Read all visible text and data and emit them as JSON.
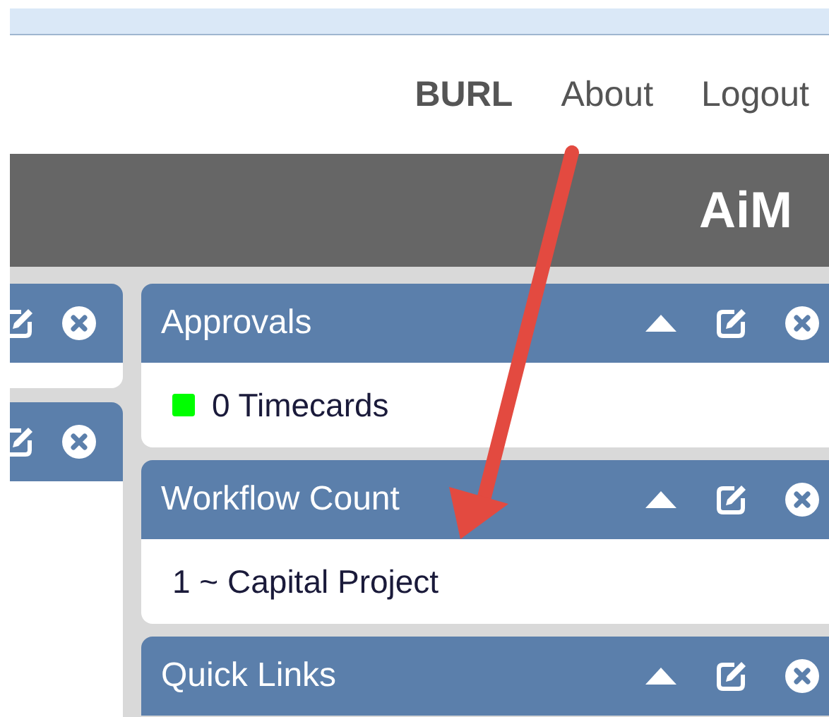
{
  "top_links": [
    {
      "label": "BURL",
      "kind": "user"
    },
    {
      "label": "About",
      "kind": "link"
    },
    {
      "label": "Logout",
      "kind": "link"
    }
  ],
  "brand": "AiM",
  "side_panels": [
    {
      "kind": "short"
    },
    {
      "kind": "tall"
    }
  ],
  "panels": [
    {
      "title": "Approvals",
      "items": [
        {
          "text": "0 Timecards",
          "color": "#00ff00"
        }
      ]
    },
    {
      "title": "Workflow Count",
      "items": [
        {
          "text": "1 ~ Capital Project"
        }
      ]
    },
    {
      "title": "Quick Links"
    }
  ]
}
